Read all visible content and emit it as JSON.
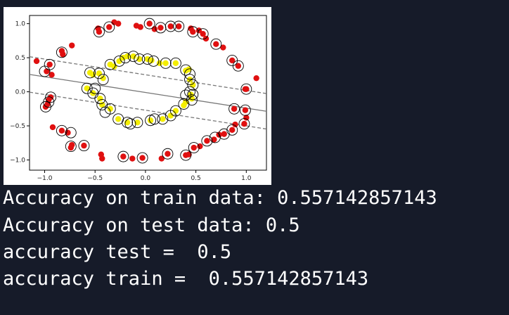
{
  "console": {
    "lines": [
      "Accuracy on train data: 0.557142857143",
      "Accuracy on test data: 0.5",
      "accuracy test =  0.5",
      "accuracy train =  0.557142857143"
    ]
  },
  "chart_data": {
    "type": "scatter",
    "title": "",
    "xlabel": "",
    "ylabel": "",
    "xlim": [
      -1.15,
      1.2
    ],
    "ylim": [
      -1.15,
      1.12
    ],
    "grid": false,
    "x_ticks": [
      -1.0,
      -0.5,
      0.0,
      0.5,
      1.0
    ],
    "x_tick_labels": [
      "−1.0",
      "−0.5",
      "0.0",
      "0.5",
      "1.0"
    ],
    "y_ticks": [
      1.0,
      0.5,
      0.0,
      -0.5,
      -1.0
    ],
    "y_tick_labels": [
      "1.0",
      "0.5",
      "0.0",
      "−0.5",
      "−1.0"
    ],
    "colors": {
      "outer": "#e01010",
      "inner": "#f4ee00",
      "support_ring": "#000000",
      "decision_line": "#777777"
    },
    "decision_boundary": {
      "slope": -0.23,
      "intercept": -0.01,
      "margin": 0.26
    },
    "series": [
      {
        "class": "outer",
        "points": [
          [
            -1.08,
            0.45
          ],
          [
            -0.98,
            0.3
          ],
          [
            -0.95,
            0.4
          ],
          [
            -0.93,
            0.25
          ],
          [
            -0.83,
            0.6
          ],
          [
            -0.82,
            0.55
          ],
          [
            -0.73,
            0.68
          ],
          [
            -0.96,
            -0.12
          ],
          [
            -0.99,
            -0.22
          ],
          [
            -0.94,
            -0.08
          ],
          [
            -0.97,
            -0.18
          ],
          [
            -0.92,
            -0.52
          ],
          [
            -0.83,
            -0.57
          ],
          [
            -0.77,
            -0.6
          ],
          [
            -0.74,
            -0.82
          ],
          [
            -0.73,
            -0.78
          ],
          [
            -0.61,
            -0.79
          ],
          [
            -0.44,
            -0.92
          ],
          [
            -0.43,
            -0.98
          ],
          [
            -0.22,
            -0.95
          ],
          [
            -0.13,
            -0.98
          ],
          [
            -0.03,
            -0.97
          ],
          [
            0.16,
            -0.98
          ],
          [
            0.22,
            -0.91
          ],
          [
            0.4,
            -0.93
          ],
          [
            0.43,
            -0.92
          ],
          [
            0.48,
            -0.82
          ],
          [
            0.54,
            -0.8
          ],
          [
            0.61,
            -0.72
          ],
          [
            0.68,
            -0.7
          ],
          [
            0.73,
            -0.63
          ],
          [
            0.78,
            -0.62
          ],
          [
            0.86,
            -0.56
          ],
          [
            0.89,
            -0.48
          ],
          [
            0.98,
            -0.47
          ],
          [
            1.0,
            -0.38
          ],
          [
            0.99,
            -0.27
          ],
          [
            0.88,
            -0.25
          ],
          [
            1.1,
            0.2
          ],
          [
            1.0,
            0.04
          ],
          [
            0.99,
            0.04
          ],
          [
            0.92,
            0.38
          ],
          [
            0.86,
            0.46
          ],
          [
            0.77,
            0.65
          ],
          [
            0.7,
            0.7
          ],
          [
            0.6,
            0.78
          ],
          [
            0.57,
            0.85
          ],
          [
            0.53,
            0.9
          ],
          [
            0.47,
            0.88
          ],
          [
            0.45,
            0.93
          ],
          [
            0.33,
            0.96
          ],
          [
            0.25,
            0.96
          ],
          [
            0.15,
            0.94
          ],
          [
            0.09,
            0.92
          ],
          [
            0.04,
            1.0
          ],
          [
            -0.05,
            0.95
          ],
          [
            -0.09,
            0.97
          ],
          [
            -0.36,
            0.95
          ],
          [
            -0.27,
            1.0
          ],
          [
            -0.31,
            1.02
          ],
          [
            -0.47,
            0.93
          ],
          [
            -0.46,
            0.88
          ]
        ]
      },
      {
        "class": "inner",
        "points": [
          [
            -0.55,
            0.28
          ],
          [
            -0.52,
            0.25
          ],
          [
            -0.46,
            0.27
          ],
          [
            -0.42,
            0.2
          ],
          [
            -0.35,
            0.4
          ],
          [
            -0.31,
            0.37
          ],
          [
            -0.26,
            0.45
          ],
          [
            -0.22,
            0.5
          ],
          [
            -0.18,
            0.52
          ],
          [
            -0.12,
            0.52
          ],
          [
            -0.06,
            0.48
          ],
          [
            0.02,
            0.48
          ],
          [
            0.06,
            0.46
          ],
          [
            0.14,
            0.42
          ],
          [
            0.2,
            0.42
          ],
          [
            0.3,
            0.42
          ],
          [
            0.4,
            0.31
          ],
          [
            0.43,
            0.33
          ],
          [
            0.44,
            0.18
          ],
          [
            0.47,
            0.1
          ],
          [
            0.45,
            -0.04
          ],
          [
            0.46,
            -0.1
          ],
          [
            0.4,
            -0.15
          ],
          [
            0.38,
            -0.2
          ],
          [
            0.3,
            -0.28
          ],
          [
            0.25,
            -0.35
          ],
          [
            0.17,
            -0.4
          ],
          [
            0.05,
            -0.42
          ],
          [
            -0.08,
            -0.45
          ],
          [
            -0.18,
            -0.45
          ],
          [
            -0.27,
            -0.4
          ],
          [
            -0.35,
            -0.25
          ],
          [
            -0.43,
            -0.19
          ],
          [
            -0.45,
            -0.1
          ],
          [
            -0.52,
            -0.02
          ],
          [
            -0.58,
            0.05
          ]
        ]
      }
    ],
    "support_vectors": [
      [
        -1.0,
        0.3
      ],
      [
        -0.95,
        0.4
      ],
      [
        -0.83,
        0.58
      ],
      [
        -0.94,
        -0.08
      ],
      [
        -0.96,
        -0.15
      ],
      [
        -0.99,
        -0.22
      ],
      [
        -0.83,
        -0.57
      ],
      [
        -0.74,
        -0.6
      ],
      [
        -0.74,
        -0.8
      ],
      [
        -0.61,
        -0.79
      ],
      [
        -0.22,
        -0.95
      ],
      [
        -0.03,
        -0.97
      ],
      [
        0.22,
        -0.91
      ],
      [
        0.4,
        -0.93
      ],
      [
        0.48,
        -0.82
      ],
      [
        0.61,
        -0.72
      ],
      [
        0.69,
        -0.67
      ],
      [
        0.78,
        -0.62
      ],
      [
        0.86,
        -0.56
      ],
      [
        0.98,
        -0.47
      ],
      [
        0.99,
        -0.27
      ],
      [
        0.88,
        -0.25
      ],
      [
        1.0,
        0.04
      ],
      [
        0.92,
        0.38
      ],
      [
        0.86,
        0.46
      ],
      [
        0.7,
        0.7
      ],
      [
        0.57,
        0.85
      ],
      [
        0.47,
        0.88
      ],
      [
        0.33,
        0.96
      ],
      [
        0.25,
        0.96
      ],
      [
        0.15,
        0.94
      ],
      [
        0.04,
        1.0
      ],
      [
        -0.36,
        0.95
      ],
      [
        -0.46,
        0.88
      ],
      [
        -0.55,
        0.28
      ],
      [
        -0.46,
        0.27
      ],
      [
        -0.42,
        0.18
      ],
      [
        -0.35,
        0.4
      ],
      [
        -0.26,
        0.45
      ],
      [
        -0.2,
        0.5
      ],
      [
        -0.12,
        0.52
      ],
      [
        -0.06,
        0.48
      ],
      [
        0.02,
        0.48
      ],
      [
        0.08,
        0.45
      ],
      [
        0.2,
        0.42
      ],
      [
        0.3,
        0.42
      ],
      [
        0.4,
        0.32
      ],
      [
        0.44,
        0.26
      ],
      [
        0.44,
        0.18
      ],
      [
        0.47,
        0.1
      ],
      [
        0.44,
        0.0
      ],
      [
        0.47,
        -0.04
      ],
      [
        0.4,
        -0.05
      ],
      [
        0.46,
        -0.12
      ],
      [
        0.38,
        -0.18
      ],
      [
        0.3,
        -0.28
      ],
      [
        0.25,
        -0.35
      ],
      [
        0.17,
        -0.4
      ],
      [
        0.09,
        -0.4
      ],
      [
        0.05,
        -0.42
      ],
      [
        -0.08,
        -0.45
      ],
      [
        -0.15,
        -0.47
      ],
      [
        -0.18,
        -0.45
      ],
      [
        -0.27,
        -0.4
      ],
      [
        -0.35,
        -0.25
      ],
      [
        -0.43,
        -0.19
      ],
      [
        -0.4,
        -0.3
      ],
      [
        -0.45,
        -0.1
      ],
      [
        -0.52,
        -0.02
      ],
      [
        -0.58,
        0.05
      ],
      [
        -0.5,
        0.05
      ]
    ]
  }
}
